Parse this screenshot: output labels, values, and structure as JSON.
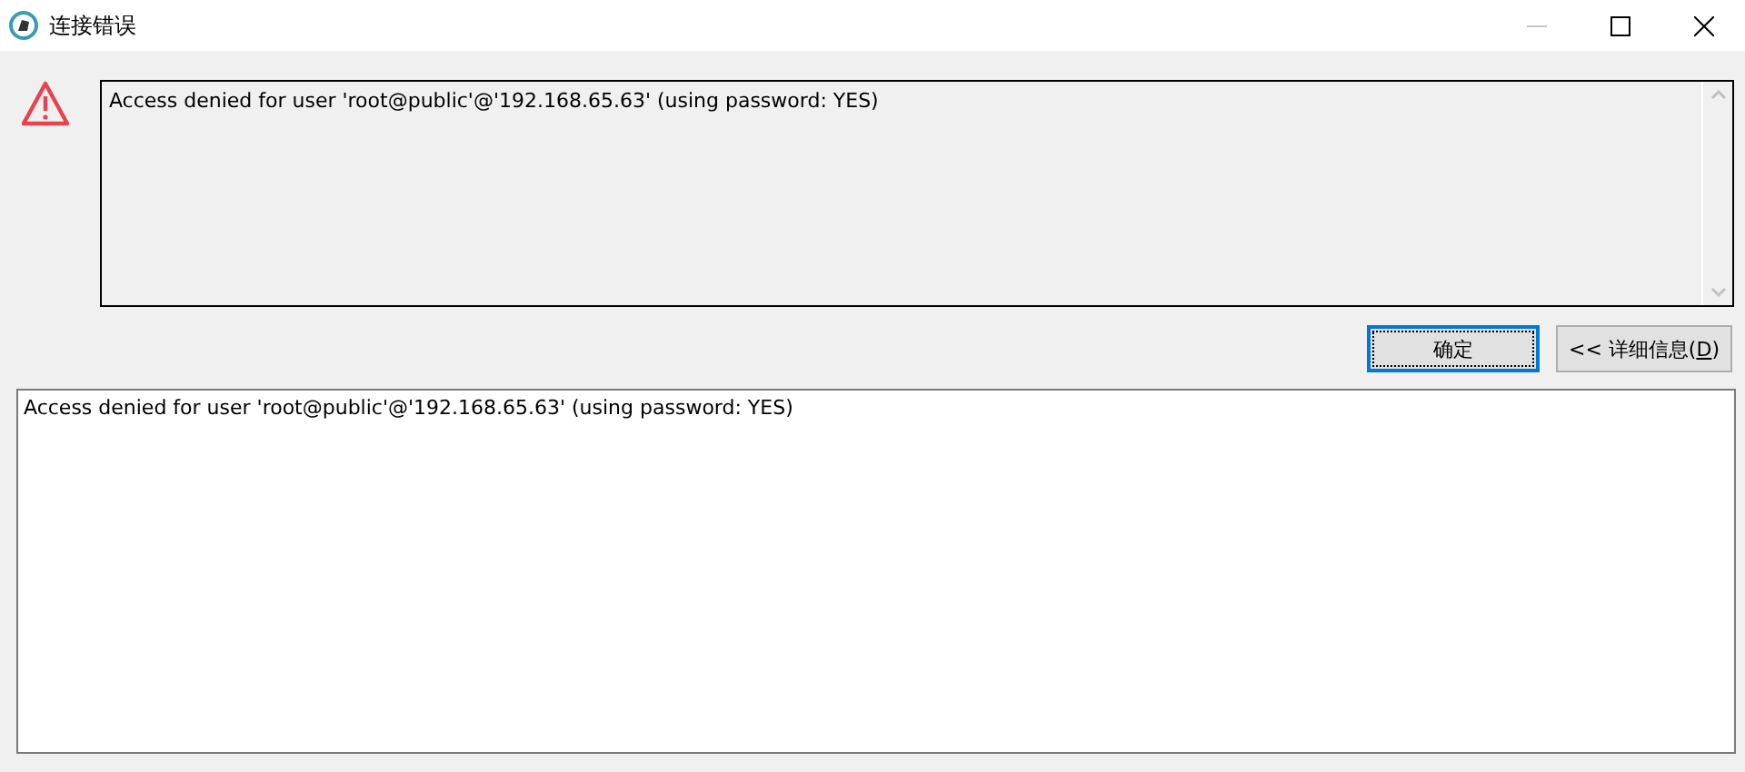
{
  "window": {
    "title": "连接错误",
    "minimize_disabled": true
  },
  "message": {
    "text": "Access denied for user 'root@public'@'192.168.65.63' (using password: YES)"
  },
  "buttons": {
    "ok": {
      "label": "确定",
      "focused": true
    },
    "details": {
      "label_before": "<< 详细信息(",
      "mnemonic": "D",
      "label_after": ")"
    }
  },
  "details_text": "Access denied for user 'root@public'@'192.168.65.63' (using password: YES)"
}
